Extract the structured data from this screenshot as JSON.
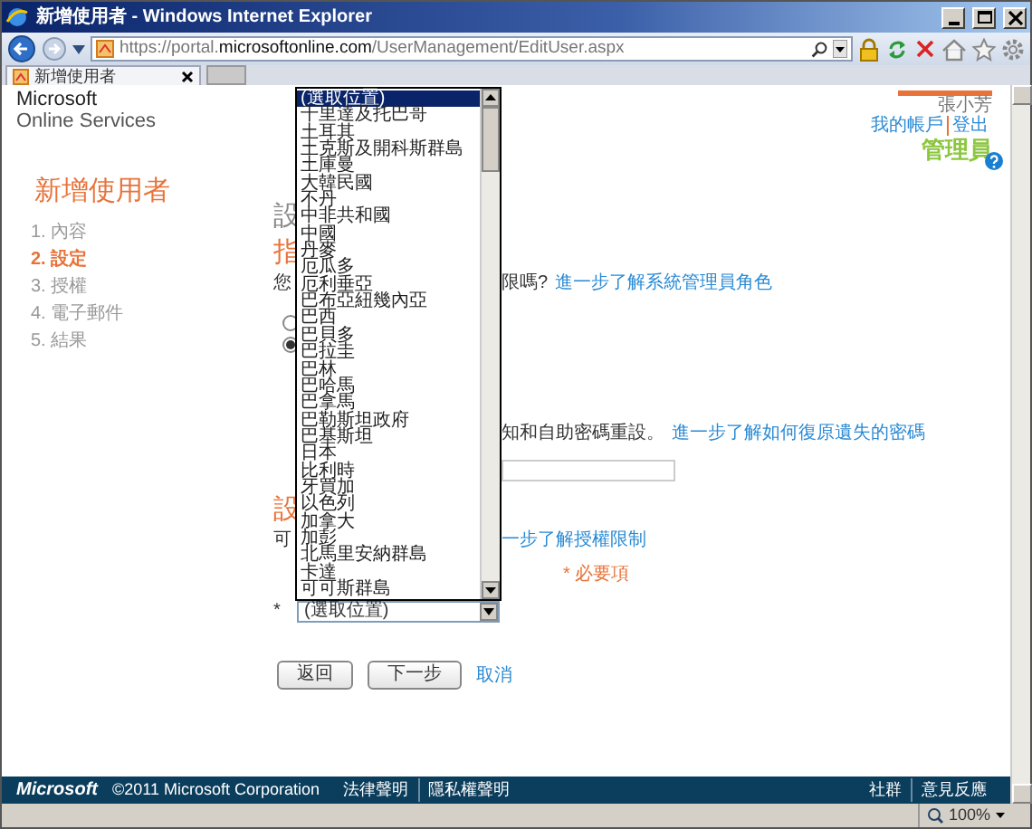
{
  "window": {
    "title": "新增使用者 - Windows Internet Explorer"
  },
  "address_bar": {
    "url_prefix": "https://portal.",
    "url_domain": "microsoftonline.com",
    "url_path": "/UserManagement/EditUser.aspx"
  },
  "tabs": [
    {
      "label": "新增使用者",
      "selected": true
    }
  ],
  "header": {
    "brand_line1": "Microsoft",
    "brand_line2": "Online Services",
    "user_name": "張小芳",
    "links": [
      "我的帳戶",
      "登出"
    ],
    "role": "管理員"
  },
  "wizard": {
    "title": "新增使用者",
    "steps": [
      {
        "number": "1.",
        "label": "內容",
        "selected": false
      },
      {
        "number": "2.",
        "label": "設定",
        "selected": true
      },
      {
        "number": "3.",
        "label": "授權",
        "selected": false
      },
      {
        "number": "4.",
        "label": "電子郵件",
        "selected": false
      },
      {
        "number": "5.",
        "label": "結果",
        "selected": false
      }
    ]
  },
  "form": {
    "heading_1": "設",
    "heading_2": "指",
    "text_left": "您",
    "text_right": "限嗎?",
    "link_1": "進一步了解系統管理員角色",
    "radios": [
      {
        "checked": false
      },
      {
        "checked": true
      }
    ],
    "password_text": "知和自助密碼重設。",
    "link_2": "進一步了解如何復原遺失的密碼",
    "heading_3": "設",
    "license_left": "可",
    "link_3": "一步了解授權限制",
    "required_note": "* 必要項",
    "location_marker": "*",
    "location_select": "(選取位置)"
  },
  "dropdown": {
    "options": [
      {
        "label": "(選取位置)",
        "selected": true
      },
      {
        "label": "千里達及托巴哥",
        "selected": false
      },
      {
        "label": "土耳其",
        "selected": false
      },
      {
        "label": "土克斯及開科斯群島",
        "selected": false
      },
      {
        "label": "土庫曼",
        "selected": false
      },
      {
        "label": "大韓民國",
        "selected": false
      },
      {
        "label": "不丹",
        "selected": false
      },
      {
        "label": "中非共和國",
        "selected": false
      },
      {
        "label": "中國",
        "selected": false
      },
      {
        "label": "丹麥",
        "selected": false
      },
      {
        "label": "厄瓜多",
        "selected": false
      },
      {
        "label": "厄利垂亞",
        "selected": false
      },
      {
        "label": "巴布亞紐幾內亞",
        "selected": false
      },
      {
        "label": "巴西",
        "selected": false
      },
      {
        "label": "巴貝多",
        "selected": false
      },
      {
        "label": "巴拉圭",
        "selected": false
      },
      {
        "label": "巴林",
        "selected": false
      },
      {
        "label": "巴哈馬",
        "selected": false
      },
      {
        "label": "巴拿馬",
        "selected": false
      },
      {
        "label": "巴勒斯坦政府",
        "selected": false
      },
      {
        "label": "巴基斯坦",
        "selected": false
      },
      {
        "label": "日本",
        "selected": false
      },
      {
        "label": "比利時",
        "selected": false
      },
      {
        "label": "牙買加",
        "selected": false
      },
      {
        "label": "以色列",
        "selected": false
      },
      {
        "label": "加拿大",
        "selected": false
      },
      {
        "label": "加彭",
        "selected": false
      },
      {
        "label": "北馬里安納群島",
        "selected": false
      },
      {
        "label": "卡達",
        "selected": false
      },
      {
        "label": "可可斯群島",
        "selected": false
      }
    ]
  },
  "buttons": [
    {
      "label": "返回"
    },
    {
      "label": "下一步"
    }
  ],
  "cancel_link": "取消",
  "footer": {
    "logo": "Microsoft",
    "copyright": "©2011 Microsoft Corporation",
    "left_links": [
      "法律聲明",
      "隱私權聲明"
    ],
    "right_links": [
      "社群",
      "意見反應"
    ]
  },
  "status_bar": {
    "zoom": "100%"
  }
}
